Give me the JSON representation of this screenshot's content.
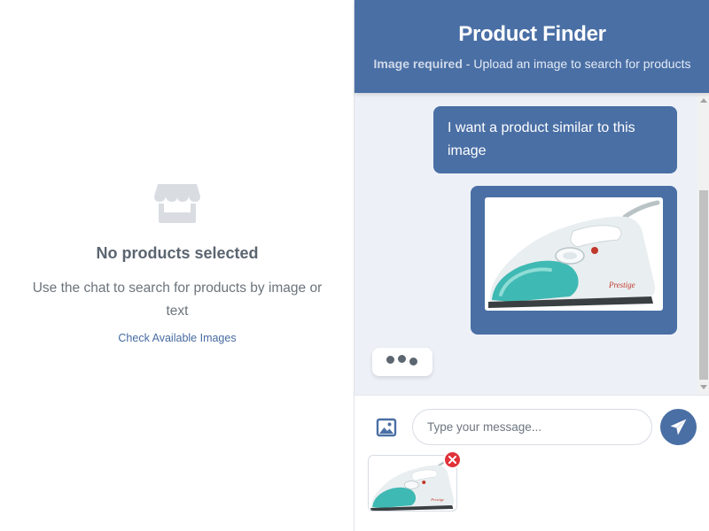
{
  "empty_state": {
    "icon": "store-icon",
    "title": "No products selected",
    "description": "Use the chat to search for products by image or text",
    "link_label": "Check Available Images"
  },
  "chat": {
    "title": "Product Finder",
    "subtitle_strong": "Image required",
    "subtitle_rest": " - Upload an image to search for products",
    "messages": [
      {
        "type": "text",
        "sender": "user",
        "text": "I want a product similar to this image"
      },
      {
        "type": "image",
        "sender": "user",
        "image": "steam-iron-photo"
      }
    ],
    "typing_indicator": true,
    "input": {
      "placeholder": "Type your message...",
      "value": ""
    },
    "attachment_preview": {
      "image": "steam-iron-photo"
    }
  },
  "colors": {
    "brand": "#4a6fa5",
    "chat_bg": "#edf1f7",
    "remove": "#e0323a",
    "iron_teal": "#3fb9b3"
  }
}
